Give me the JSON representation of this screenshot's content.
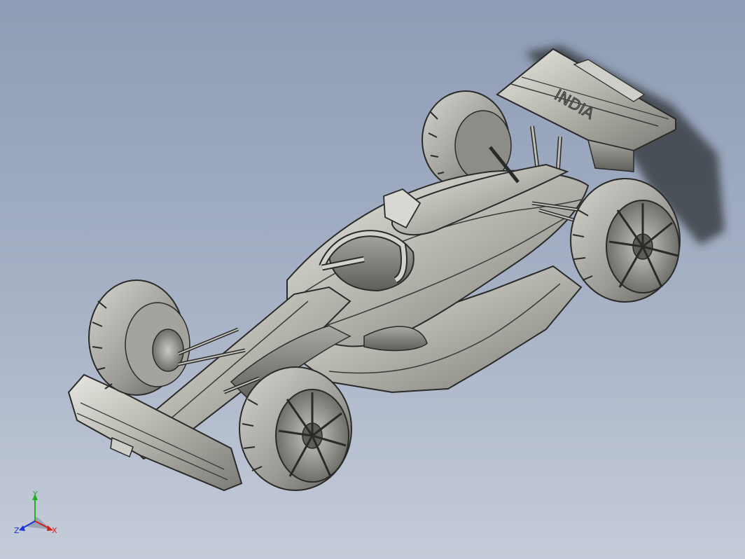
{
  "model": {
    "wing_text": "INDIA"
  },
  "triad": {
    "x_label": "X",
    "y_label": "Y",
    "z_label": "Z",
    "x_color": "#d02020",
    "y_color": "#20b020",
    "z_color": "#2030d0"
  }
}
